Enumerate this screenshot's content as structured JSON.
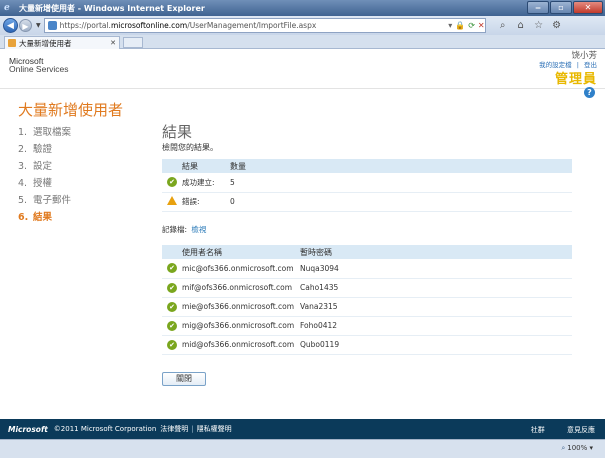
{
  "window": {
    "title": "大量新增使用者 - Windows Internet Explorer"
  },
  "browser": {
    "url_prefix": "https://portal.",
    "url_host": "microsoftonline.com",
    "url_path": "/UserManagement/ImportFile.aspx",
    "tab_label": "大量新增使用者",
    "zoom": "100%"
  },
  "header": {
    "brand_line1": "Microsoft",
    "brand_line2": "Online Services",
    "user_name": "饶小芳",
    "link_profile": "我的設定檔",
    "link_separator": "|",
    "link_signout": "登出",
    "role": "管理員"
  },
  "page": {
    "title": "大量新增使用者",
    "steps": [
      {
        "num": "1.",
        "label": "選取檔案"
      },
      {
        "num": "2.",
        "label": "驗證"
      },
      {
        "num": "3.",
        "label": "設定"
      },
      {
        "num": "4.",
        "label": "授權"
      },
      {
        "num": "5.",
        "label": "電子郵件"
      },
      {
        "num": "6.",
        "label": "結果"
      }
    ]
  },
  "results": {
    "title": "結果",
    "subtitle": "檢閱您的結果。",
    "summary_headers": [
      "結果",
      "數量"
    ],
    "summary_rows": [
      {
        "status": "success",
        "label": "成功建立:",
        "count": "5"
      },
      {
        "status": "warning",
        "label": "錯誤:",
        "count": "0"
      }
    ],
    "log_label": "記錄檔:",
    "log_link": "檢視",
    "user_headers": [
      "使用者名稱",
      "暫時密碼"
    ],
    "users": [
      {
        "name": "mic@ofs366.onmicrosoft.com",
        "password": "Nuqa3094"
      },
      {
        "name": "mif@ofs366.onmicrosoft.com",
        "password": "Caho1435"
      },
      {
        "name": "mie@ofs366.onmicrosoft.com",
        "password": "Vana2315"
      },
      {
        "name": "mig@ofs366.onmicrosoft.com",
        "password": "Foho0412"
      },
      {
        "name": "mid@ofs366.onmicrosoft.com",
        "password": "Qubo0119"
      }
    ],
    "close_button": "關閉"
  },
  "footer": {
    "logo": "Microsoft",
    "copyright": "©2011 Microsoft Corporation",
    "legal": "法律聲明",
    "privacy": "隱私權聲明",
    "community": "社群",
    "feedback": "意見反應"
  }
}
